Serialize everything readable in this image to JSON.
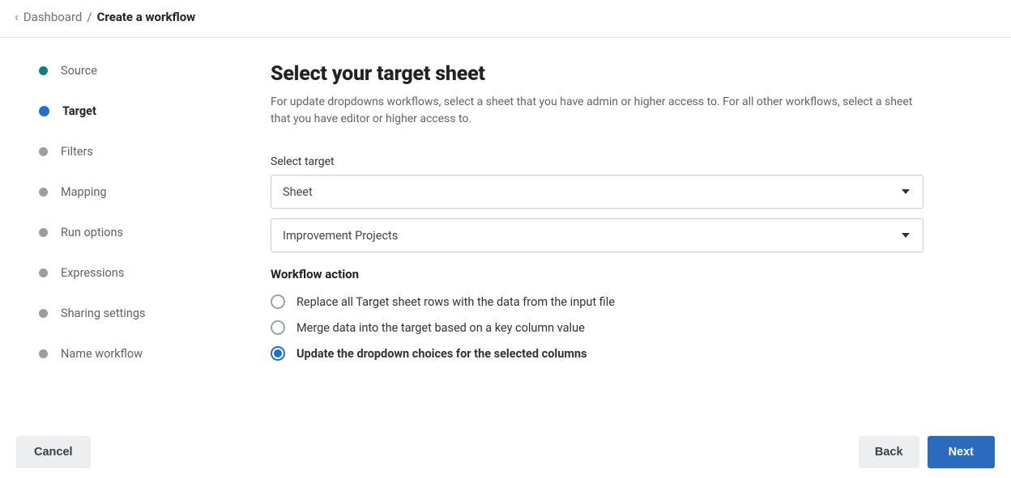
{
  "breadcrumb": {
    "parent": "Dashboard",
    "separator": "/",
    "current": "Create a workflow"
  },
  "sidebar": {
    "steps": [
      {
        "label": "Source",
        "state": "done"
      },
      {
        "label": "Target",
        "state": "active"
      },
      {
        "label": "Filters",
        "state": "pending"
      },
      {
        "label": "Mapping",
        "state": "pending"
      },
      {
        "label": "Run options",
        "state": "pending"
      },
      {
        "label": "Expressions",
        "state": "pending"
      },
      {
        "label": "Sharing settings",
        "state": "pending"
      },
      {
        "label": "Name workflow",
        "state": "pending"
      }
    ]
  },
  "main": {
    "title": "Select your target sheet",
    "subtitle": "For update dropdowns workflows, select a sheet that you have admin or higher access to. For all other workflows, select a sheet that you have editor or higher access to.",
    "select_target_label": "Select target",
    "target_type": {
      "value": "Sheet"
    },
    "target_sheet": {
      "value": "Improvement Projects"
    },
    "workflow_action_heading": "Workflow action",
    "actions": [
      {
        "label": "Replace all Target sheet rows with the data from the input file",
        "selected": false
      },
      {
        "label": "Merge data into the target based on a key column value",
        "selected": false
      },
      {
        "label": "Update the dropdown choices for the selected columns",
        "selected": true
      }
    ]
  },
  "footer": {
    "cancel": "Cancel",
    "back": "Back",
    "next": "Next"
  }
}
